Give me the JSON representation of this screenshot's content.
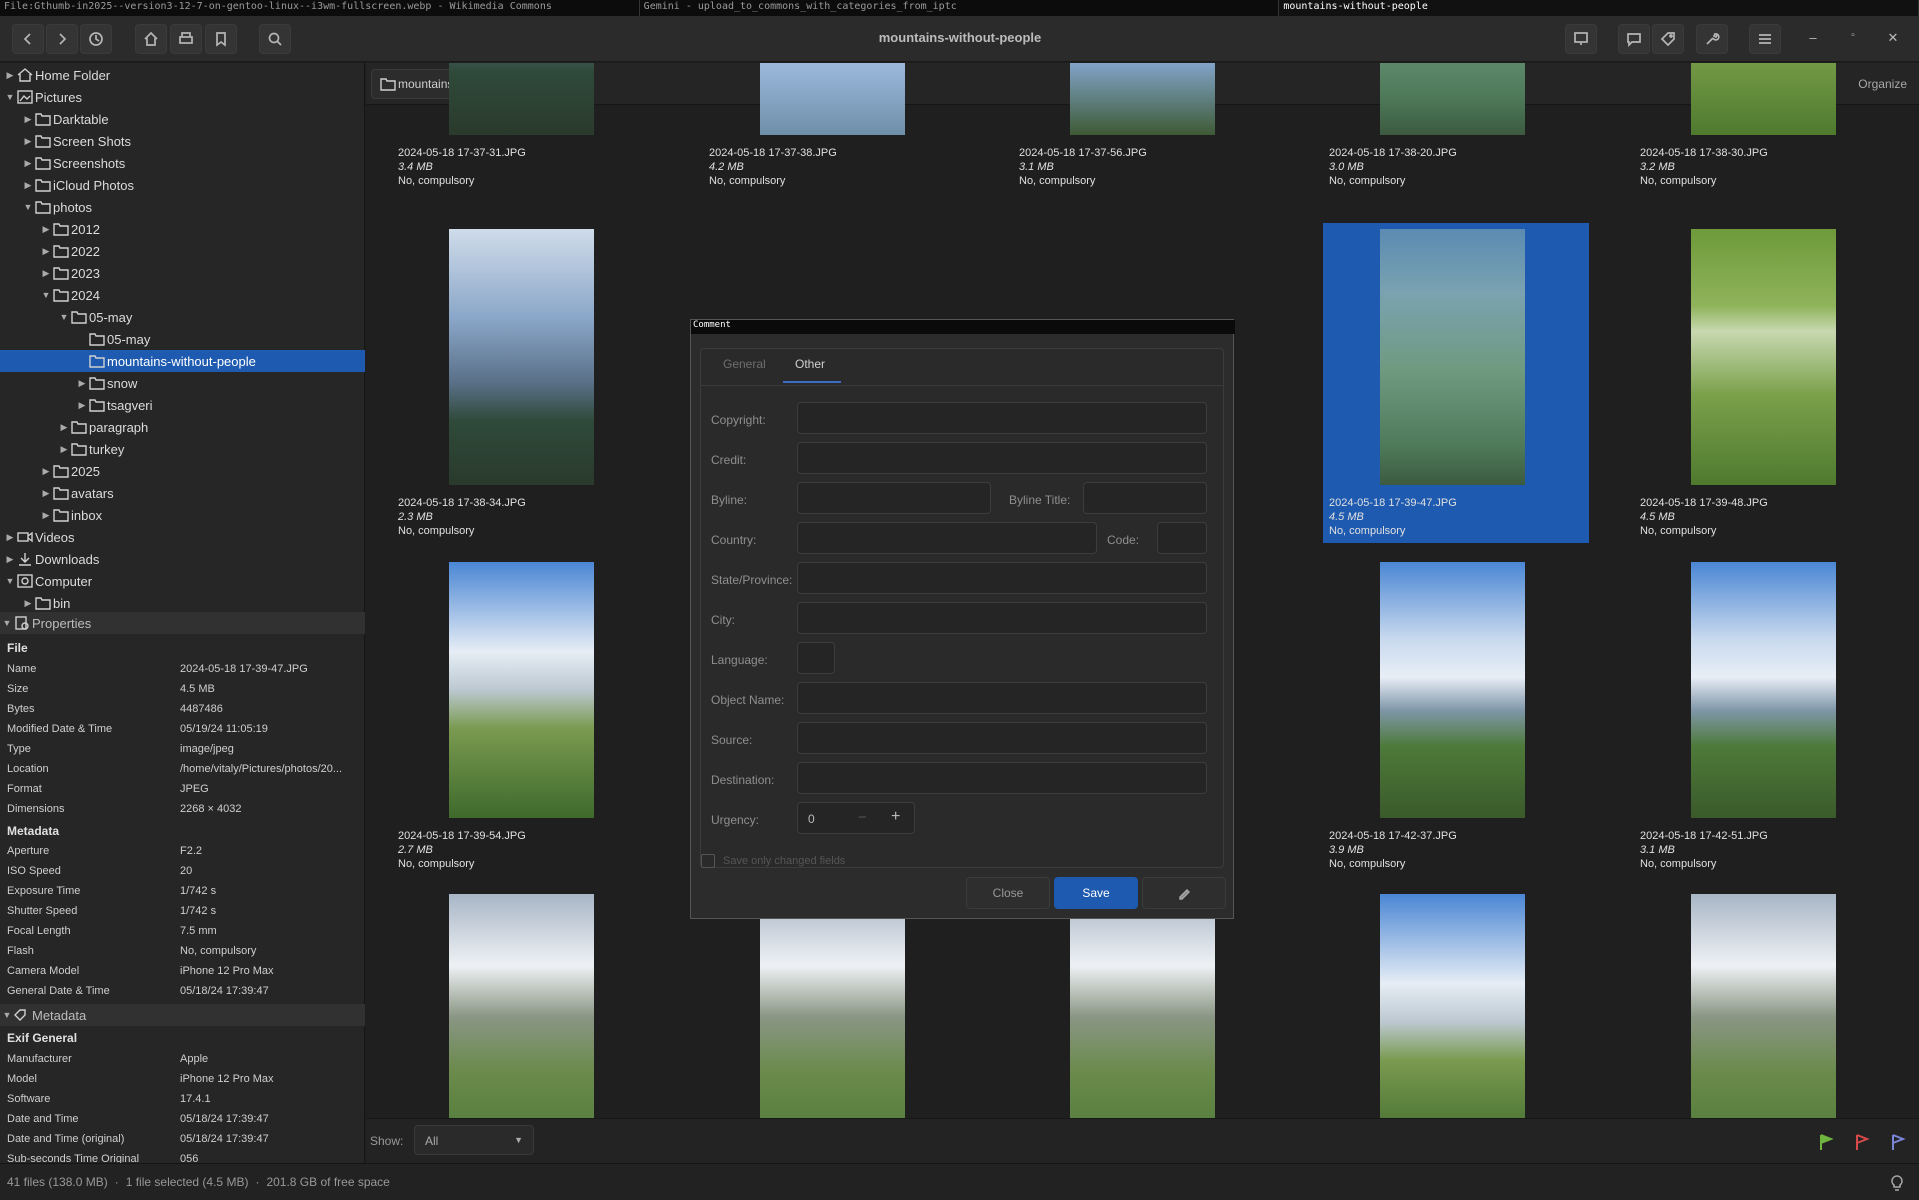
{
  "tabs": [
    "File:Gthumb-in2025--version3-12-7-on-gentoo-linux--i3wm-fullscreen.webp - Wikimedia Commons",
    "Gemini - upload_to_commons_with_categories_from_iptc",
    "mountains-without-people"
  ],
  "window": {
    "title": "mountains-without-people"
  },
  "tree": [
    {
      "label": "Home Folder",
      "depth": 0,
      "arrow": "▶",
      "icon": "home"
    },
    {
      "label": "Pictures",
      "depth": 0,
      "arrow": "▼",
      "icon": "pic"
    },
    {
      "label": "Darktable",
      "depth": 1,
      "arrow": "▶",
      "icon": "folder"
    },
    {
      "label": "Screen Shots",
      "depth": 1,
      "arrow": "▶",
      "icon": "folder"
    },
    {
      "label": "Screenshots",
      "depth": 1,
      "arrow": "▶",
      "icon": "folder"
    },
    {
      "label": "iCloud Photos",
      "depth": 1,
      "arrow": "▶",
      "icon": "folder"
    },
    {
      "label": "photos",
      "depth": 1,
      "arrow": "▼",
      "icon": "folder"
    },
    {
      "label": "2012",
      "depth": 2,
      "arrow": "▶",
      "icon": "folder"
    },
    {
      "label": "2022",
      "depth": 2,
      "arrow": "▶",
      "icon": "folder"
    },
    {
      "label": "2023",
      "depth": 2,
      "arrow": "▶",
      "icon": "folder"
    },
    {
      "label": "2024",
      "depth": 2,
      "arrow": "▼",
      "icon": "folder"
    },
    {
      "label": "05-may",
      "depth": 3,
      "arrow": "▼",
      "icon": "folder"
    },
    {
      "label": "05-may",
      "depth": 4,
      "arrow": "",
      "icon": "folder"
    },
    {
      "label": "mountains-without-people",
      "depth": 4,
      "arrow": "",
      "icon": "folder",
      "selected": true
    },
    {
      "label": "snow",
      "depth": 4,
      "arrow": "▶",
      "icon": "folder"
    },
    {
      "label": "tsagveri",
      "depth": 4,
      "arrow": "▶",
      "icon": "folder"
    },
    {
      "label": "paragraph",
      "depth": 3,
      "arrow": "▶",
      "icon": "folder"
    },
    {
      "label": "turkey",
      "depth": 3,
      "arrow": "▶",
      "icon": "folder"
    },
    {
      "label": "2025",
      "depth": 2,
      "arrow": "▶",
      "icon": "folder"
    },
    {
      "label": "avatars",
      "depth": 2,
      "arrow": "▶",
      "icon": "folder"
    },
    {
      "label": "inbox",
      "depth": 2,
      "arrow": "▶",
      "icon": "folder"
    },
    {
      "label": "Videos",
      "depth": 0,
      "arrow": "▶",
      "icon": "video"
    },
    {
      "label": "Downloads",
      "depth": 0,
      "arrow": "▶",
      "icon": "download"
    },
    {
      "label": "Computer",
      "depth": 0,
      "arrow": "▼",
      "icon": "computer"
    },
    {
      "label": "bin",
      "depth": 1,
      "arrow": "▶",
      "icon": "folder"
    }
  ],
  "properties": {
    "header": "Properties",
    "file_group": "File",
    "file": [
      [
        "Name",
        "2024-05-18 17-39-47.JPG"
      ],
      [
        "Size",
        "4.5 MB"
      ],
      [
        "Bytes",
        "4487486"
      ],
      [
        "Modified Date & Time",
        "05/19/24 11:05:19"
      ],
      [
        "Type",
        "image/jpeg"
      ],
      [
        "Location",
        "/home/vitaly/Pictures/photos/20..."
      ],
      [
        "Format",
        "JPEG"
      ],
      [
        "Dimensions",
        "2268 × 4032"
      ]
    ],
    "meta_group": "Metadata",
    "meta": [
      [
        "Aperture",
        "F2.2"
      ],
      [
        "ISO Speed",
        "20"
      ],
      [
        "Exposure Time",
        "1/742 s"
      ],
      [
        "Shutter Speed",
        "1/742 s"
      ],
      [
        "Focal Length",
        "7.5 mm"
      ],
      [
        "Flash",
        "No, compulsory"
      ],
      [
        "Camera Model",
        "iPhone 12 Pro Max"
      ],
      [
        "General Date & Time",
        "05/18/24 17:39:47"
      ]
    ]
  },
  "metadata": {
    "header": "Metadata",
    "group": "Exif General",
    "rows": [
      [
        "Manufacturer",
        "Apple"
      ],
      [
        "Model",
        "iPhone 12 Pro Max"
      ],
      [
        "Software",
        "17.4.1"
      ],
      [
        "Date and Time",
        "05/18/24 17:39:47"
      ],
      [
        "Date and Time (original)",
        "05/18/24 17:39:47"
      ],
      [
        "Sub-seconds Time Original",
        "056"
      ]
    ]
  },
  "pathbar": {
    "folder": "mountains-without-people",
    "organize": "Organize"
  },
  "thumbs": [
    {
      "name": "2024-05-18 17-37-31.JPG",
      "size": "3.4 MB",
      "flash": "No, compulsory"
    },
    {
      "name": "2024-05-18 17-37-38.JPG",
      "size": "4.2 MB",
      "flash": "No, compulsory"
    },
    {
      "name": "2024-05-18 17-37-56.JPG",
      "size": "3.1 MB",
      "flash": "No, compulsory"
    },
    {
      "name": "2024-05-18 17-38-20.JPG",
      "size": "3.0 MB",
      "flash": "No, compulsory"
    },
    {
      "name": "2024-05-18 17-38-30.JPG",
      "size": "3.2 MB",
      "flash": "No, compulsory"
    },
    {
      "name": "2024-05-18 17-38-34.JPG",
      "size": "2.3 MB",
      "flash": "No, compulsory"
    },
    {
      "name": "",
      "size": "",
      "flash": ""
    },
    {
      "name": "",
      "size": "",
      "flash": ""
    },
    {
      "name": "2024-05-18 17-39-47.JPG",
      "size": "4.5 MB",
      "flash": "No, compulsory",
      "selected": true
    },
    {
      "name": "2024-05-18 17-39-48.JPG",
      "size": "4.5 MB",
      "flash": "No, compulsory"
    },
    {
      "name": "2024-05-18 17-39-54.JPG",
      "size": "2.7 MB",
      "flash": "No, compulsory"
    },
    {
      "name": "",
      "size": "",
      "flash": ""
    },
    {
      "name": "",
      "size": "",
      "flash": ""
    },
    {
      "name": "2024-05-18 17-42-37.JPG",
      "size": "3.9 MB",
      "flash": "No, compulsory"
    },
    {
      "name": "2024-05-18 17-42-51.JPG",
      "size": "3.1 MB",
      "flash": "No, compulsory"
    }
  ],
  "showbar": {
    "label": "Show:",
    "value": "All"
  },
  "status": {
    "files": "41 files (138.0 MB)",
    "selected": "1 file selected (4.5 MB)",
    "free": "201.8 GB of free space",
    "sep": "·"
  },
  "dialog": {
    "title": "Comment",
    "tabs": [
      "General",
      "Other"
    ],
    "active_tab": "Other",
    "fields": {
      "copyright": "Copyright:",
      "credit": "Credit:",
      "byline": "Byline:",
      "byline_title": "Byline Title:",
      "country": "Country:",
      "code": "Code:",
      "state": "State/Province:",
      "city": "City:",
      "language": "Language:",
      "object": "Object Name:",
      "source": "Source:",
      "destination": "Destination:",
      "urgency": "Urgency:"
    },
    "urgency_value": "0",
    "save_changed": "Save only changed fields",
    "close": "Close",
    "save": "Save"
  },
  "colors": {
    "accent": "#1e5bb0"
  }
}
